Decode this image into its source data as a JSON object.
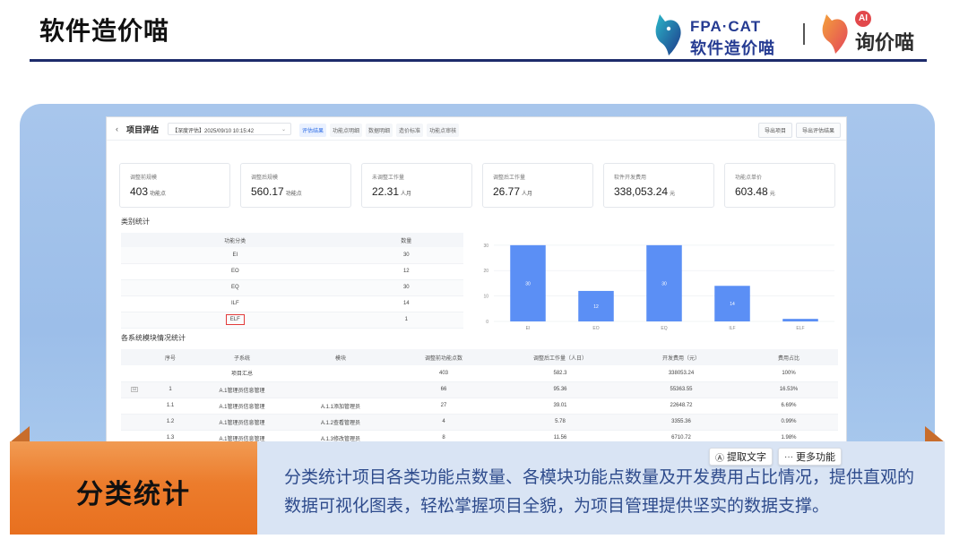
{
  "slide": {
    "title": "软件造价喵",
    "logo_fpa_line1": "FPA·CAT",
    "logo_fpa_line2": "软件造价喵",
    "logo_ai_badge": "AI",
    "logo_ai_text": "询价喵"
  },
  "colors": {
    "accent_orange": "#ec7c2c",
    "accent_navy": "#1d2b6b",
    "bar_blue": "#5b8ff5",
    "highlight_red": "#e23b3b",
    "desc_text": "#2e4b8c"
  },
  "app": {
    "back_icon": "chevron-left-icon",
    "title": "项目评估",
    "project_select": "【深度评估】2025/09/10 10:15:42",
    "tabs": [
      "评估结果",
      "功能点明细",
      "数据明细",
      "造价标准",
      "功能点审核"
    ],
    "active_tab": 0,
    "buttons": [
      "导出项目",
      "导出评估结果"
    ]
  },
  "kpis": [
    {
      "label": "调整前规模",
      "value": "403",
      "unit": "功能点"
    },
    {
      "label": "调整后规模",
      "value": "560.17",
      "unit": "功能点"
    },
    {
      "label": "未调整工作量",
      "value": "22.31",
      "unit": "人月"
    },
    {
      "label": "调整后工作量",
      "value": "26.77",
      "unit": "人月"
    },
    {
      "label": "软件开发费用",
      "value": "338,053.24",
      "unit": "元"
    },
    {
      "label": "功能点单价",
      "value": "603.48",
      "unit": "元"
    }
  ],
  "category": {
    "title": "类别统计",
    "headers": [
      "功能分类",
      "数量"
    ],
    "rows": [
      {
        "type": "EI",
        "count": "30"
      },
      {
        "type": "EO",
        "count": "12"
      },
      {
        "type": "EQ",
        "count": "30"
      },
      {
        "type": "ILF",
        "count": "14"
      },
      {
        "type": "ELF",
        "count": "1"
      }
    ]
  },
  "chart_data": {
    "type": "bar",
    "categories": [
      "EI",
      "EO",
      "EQ",
      "ILF",
      "ELF"
    ],
    "values": [
      30,
      12,
      30,
      14,
      1
    ],
    "data_labels": [
      "30",
      "12",
      "30",
      "14",
      ""
    ],
    "yticks": [
      0,
      10,
      20,
      30
    ],
    "ylim": [
      0,
      31
    ],
    "grid": true,
    "color": "#5b8ff5"
  },
  "modules": {
    "title": "各系统模块情况统计",
    "headers": [
      "",
      "序号",
      "子系统",
      "模块",
      "调整前功能点数",
      "调整后工作量（人日）",
      "开发费用（元）",
      "费用占比"
    ],
    "rows": [
      [
        "",
        "",
        "项目汇总",
        "",
        "403",
        "582.3",
        "338053.24",
        "100%"
      ],
      [
        "⊟",
        "1",
        "A.1管理员信息管理",
        "",
        "66",
        "95.36",
        "55363.55",
        "16.53%"
      ],
      [
        "",
        "1.1",
        "A.1管理员信息管理",
        "A.1.1添加管理员",
        "27",
        "39.01",
        "22648.72",
        "6.69%"
      ],
      [
        "",
        "1.2",
        "A.1管理员信息管理",
        "A.1.2查看管理员",
        "4",
        "5.78",
        "3355.36",
        "0.99%"
      ],
      [
        "",
        "1.3",
        "A.1管理员信息管理",
        "A.1.3修改管理员",
        "8",
        "11.56",
        "6710.72",
        "1.98%"
      ]
    ]
  },
  "caption": {
    "label": "分类统计",
    "description": "分类统计项目各类功能点数量、各模块功能点数量及开发费用占比情况，提供直观的数据可视化图表，轻松掌握项目全貌，为项目管理提供坚实的数据支撑。"
  },
  "float_toolbar": {
    "extract_icon": "text-extract-icon",
    "extract_label": "提取文字",
    "more_icon": "ellipsis-icon",
    "more_label": "更多功能"
  }
}
